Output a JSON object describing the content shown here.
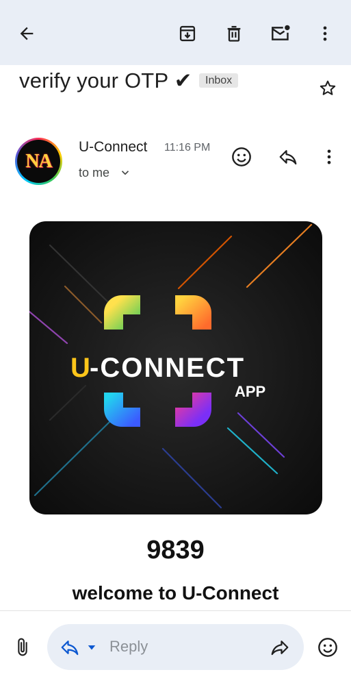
{
  "toolbar": {
    "back_icon": "arrow-back-icon",
    "archive_icon": "archive-icon",
    "delete_icon": "delete-icon",
    "mark_unread_icon": "mail-unread-icon",
    "more_icon": "more-vert-icon"
  },
  "email": {
    "subject": "verify your OTP ✔",
    "label": "Inbox",
    "sender": "U-Connect",
    "time": "11:16 PM",
    "recipient": "to me",
    "avatar_text": "NA",
    "banner": {
      "brand_prefix": "U",
      "brand_rest": "-CONNECT",
      "brand_sub": "APP"
    },
    "otp": "9839",
    "welcome": "welcome to U-Connect"
  },
  "reply_bar": {
    "reply_label": "Reply"
  },
  "colors": {
    "toolbar_bg": "#e9eef6",
    "reply_pill_bg": "#e9eef6",
    "reply_icon": "#0b57d0",
    "brand_yellow": "#ffd23f"
  }
}
